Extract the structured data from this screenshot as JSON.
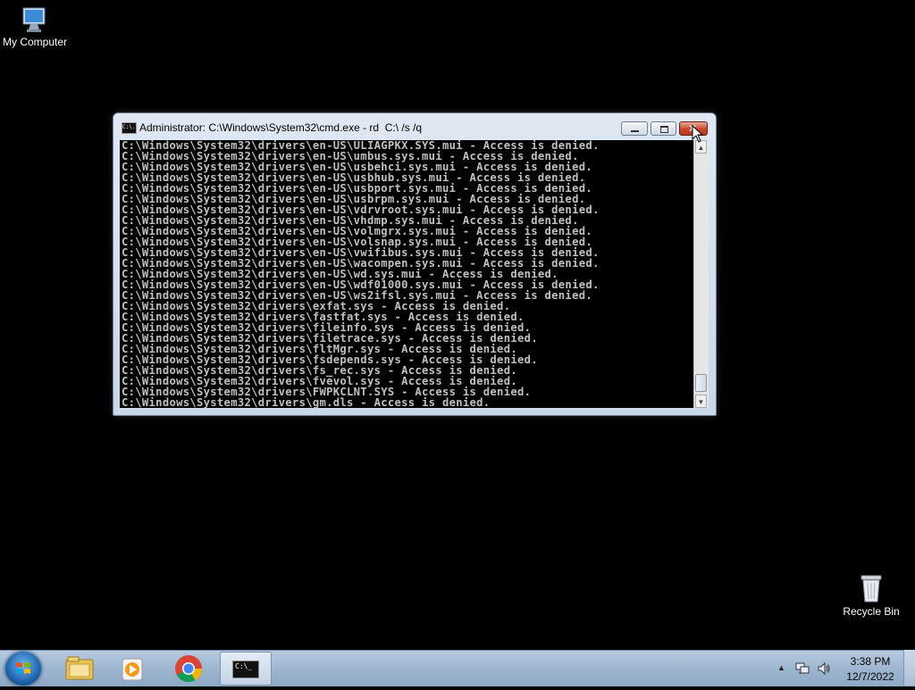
{
  "desktop": {
    "icons": [
      {
        "label": "My Computer",
        "icon": "computer-icon"
      },
      {
        "label": "Recycle Bin",
        "icon": "recycle-bin-icon"
      }
    ]
  },
  "window": {
    "title": "Administrator: C:\\Windows\\System32\\cmd.exe - rd  C:\\ /s /q",
    "icon": "cmd-icon",
    "icon_text": "C:\\.",
    "controls": {
      "minimize": "minimize-icon",
      "maximize": "maximize-icon",
      "close": "close-icon",
      "close_glyph": "✕"
    },
    "console_lines": [
      "C:\\Windows\\System32\\drivers\\en-US\\ULIAGPKX.SYS.mui - Access is denied.",
      "C:\\Windows\\System32\\drivers\\en-US\\umbus.sys.mui - Access is denied.",
      "C:\\Windows\\System32\\drivers\\en-US\\usbehci.sys.mui - Access is denied.",
      "C:\\Windows\\System32\\drivers\\en-US\\usbhub.sys.mui - Access is denied.",
      "C:\\Windows\\System32\\drivers\\en-US\\usbport.sys.mui - Access is denied.",
      "C:\\Windows\\System32\\drivers\\en-US\\usbrpm.sys.mui - Access is denied.",
      "C:\\Windows\\System32\\drivers\\en-US\\vdrvroot.sys.mui - Access is denied.",
      "C:\\Windows\\System32\\drivers\\en-US\\vhdmp.sys.mui - Access is denied.",
      "C:\\Windows\\System32\\drivers\\en-US\\volmgrx.sys.mui - Access is denied.",
      "C:\\Windows\\System32\\drivers\\en-US\\volsnap.sys.mui - Access is denied.",
      "C:\\Windows\\System32\\drivers\\en-US\\vwifibus.sys.mui - Access is denied.",
      "C:\\Windows\\System32\\drivers\\en-US\\wacompen.sys.mui - Access is denied.",
      "C:\\Windows\\System32\\drivers\\en-US\\wd.sys.mui - Access is denied.",
      "C:\\Windows\\System32\\drivers\\en-US\\wdf01000.sys.mui - Access is denied.",
      "C:\\Windows\\System32\\drivers\\en-US\\ws2ifsl.sys.mui - Access is denied.",
      "C:\\Windows\\System32\\drivers\\exfat.sys - Access is denied.",
      "C:\\Windows\\System32\\drivers\\fastfat.sys - Access is denied.",
      "C:\\Windows\\System32\\drivers\\fileinfo.sys - Access is denied.",
      "C:\\Windows\\System32\\drivers\\filetrace.sys - Access is denied.",
      "C:\\Windows\\System32\\drivers\\fltMgr.sys - Access is denied.",
      "C:\\Windows\\System32\\drivers\\fsdepends.sys - Access is denied.",
      "C:\\Windows\\System32\\drivers\\fs_rec.sys - Access is denied.",
      "C:\\Windows\\System32\\drivers\\fvevol.sys - Access is denied.",
      "C:\\Windows\\System32\\drivers\\FWPKCLNT.SYS - Access is denied.",
      "C:\\Windows\\System32\\drivers\\gm.dls - Access is denied."
    ]
  },
  "taskbar": {
    "start_icon": "windows-start-icon",
    "pinned": [
      "windows-explorer-icon",
      "windows-media-player-icon",
      "chrome-icon",
      "cmd-icon"
    ],
    "cmd_icon_text": "C:\\_",
    "tray": {
      "overflow_icon": "show-hidden-icons-icon",
      "overflow_glyph": "▲",
      "network_icon": "network-icon",
      "volume_icon": "volume-icon",
      "time": "3:38 PM",
      "date": "12/7/2022"
    }
  },
  "colors": {
    "console_text": "#c0c0c0",
    "console_bg": "#000000",
    "desktop_bg": "#000000",
    "close_button": "#c7442a"
  }
}
